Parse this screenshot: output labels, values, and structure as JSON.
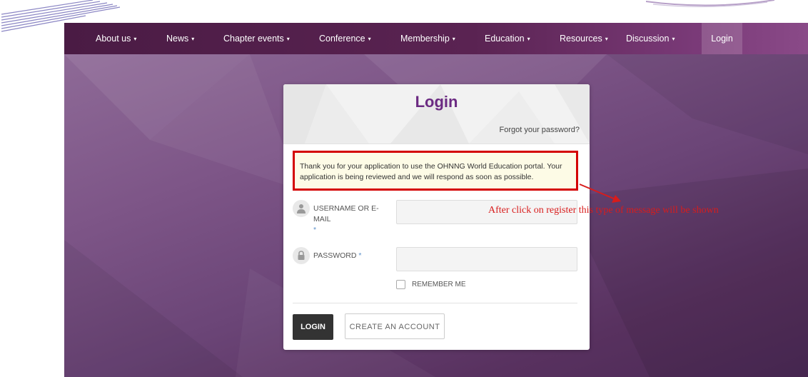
{
  "nav": {
    "items": [
      {
        "label": "About us"
      },
      {
        "label": "News"
      },
      {
        "label": "Chapter events"
      },
      {
        "label": "Conference"
      },
      {
        "label": "Membership"
      },
      {
        "label": "Education"
      },
      {
        "label": "Resources"
      },
      {
        "label": "Discussion"
      }
    ],
    "dropdown_caret": "▾",
    "login_label": "Login"
  },
  "login_card": {
    "title": "Login",
    "forgot_password": "Forgot your password?",
    "message": "Thank you for your application to use the OHNNG World Education portal. Your application is being reviewed and we will respond as soon as possible.",
    "username_label": "USERNAME OR E-MAIL",
    "username_value": "",
    "password_label": "PASSWORD",
    "password_value": "",
    "required_marker": "*",
    "remember_label": "REMEMBER ME",
    "remember_checked": false,
    "login_button": "LOGIN",
    "create_account_button": "CREATE AN ACCOUNT"
  },
  "annotation": {
    "text": "After click on register this type of message will be shown",
    "color": "#d81c1c"
  },
  "colors": {
    "accent": "#6b2a82",
    "navbar": "#4a1b44",
    "highlight_border": "#d40000"
  }
}
